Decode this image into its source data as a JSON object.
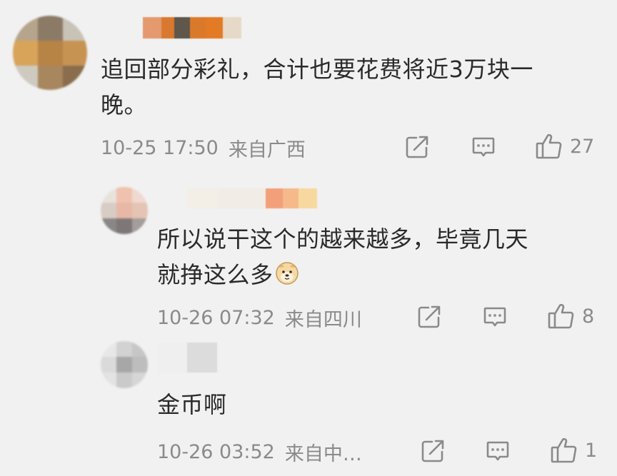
{
  "comments": [
    {
      "text_line1": "追回部分彩礼，合计也要花费将近3万块一",
      "text_line2": "晚。",
      "time": "10-25 17:50",
      "location": "来自广西",
      "like_count": "27"
    },
    {
      "text_line1": "所以说干这个的越来越多，毕竟几天",
      "text_line2": "就挣这么多",
      "emoji": "doge-emoji",
      "time": "10-26 07:32",
      "location": "来自四川",
      "like_count": "8"
    },
    {
      "text_line1": "金币啊",
      "time": "10-26 03:52",
      "location": "来自中…",
      "like_count": "1"
    }
  ],
  "colors": {
    "background": "#f1f1f1",
    "text": "#2a2a2a",
    "meta": "#8a8a8a",
    "icon": "#8a8a8a"
  },
  "icons": [
    "share-icon",
    "comment-icon",
    "like-icon"
  ]
}
